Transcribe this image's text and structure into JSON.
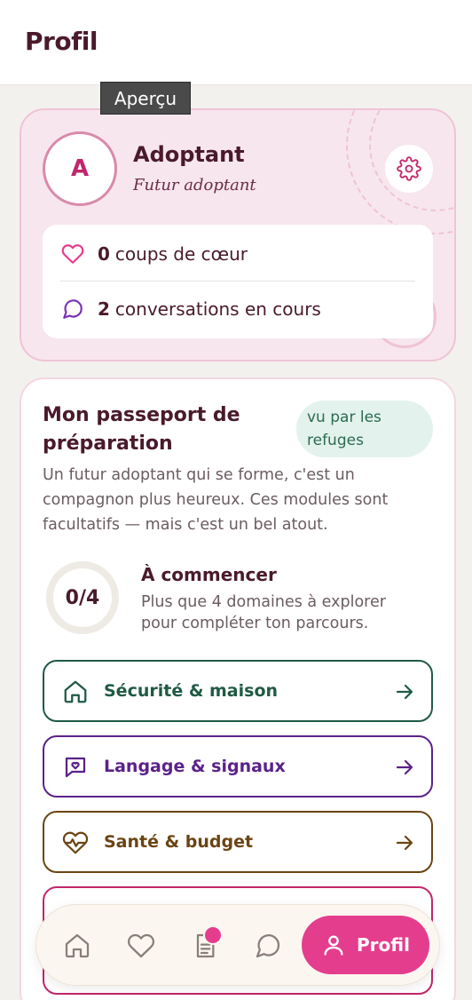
{
  "header": {
    "title": "Profil"
  },
  "tooltip": {
    "text": "Aperçu"
  },
  "profile": {
    "avatar_initial": "A",
    "name": "Adoptant",
    "role": "Futur adoptant",
    "settings_icon": "gear-icon"
  },
  "stats": [
    {
      "icon": "heart-icon",
      "count": "0",
      "label": "coups de cœur"
    },
    {
      "icon": "chat-bubble-icon",
      "count": "2",
      "label": "conversations en cours"
    }
  ],
  "passport": {
    "title": "Mon passeport de préparation",
    "badge": "vu par les refuges",
    "description": "Un futur adoptant qui se forme, c'est un compagnon plus heureux. Ces modules sont facultatifs — mais c'est un bel atout.",
    "progress": {
      "completed": 0,
      "total": 4,
      "text": "0/4"
    },
    "status_title": "À commencer",
    "status_sub": "Plus que 4 domaines à explorer pour compléter ton parcours.",
    "modules": [
      {
        "label": "Sécurité & maison",
        "icon": "home-icon",
        "color": "#1f5a44"
      },
      {
        "label": "Langage & signaux",
        "icon": "message-heart-icon",
        "color": "#5b2289"
      },
      {
        "label": "Santé & budget",
        "icon": "heart-pulse-icon",
        "color": "#6b4413"
      },
      {
        "label": "",
        "icon": "",
        "color": "#c2266a"
      }
    ]
  },
  "nav": {
    "items": [
      {
        "icon": "home-icon"
      },
      {
        "icon": "heart-icon"
      },
      {
        "icon": "document-icon",
        "has_badge": true
      },
      {
        "icon": "chat-bubble-icon"
      }
    ],
    "active": {
      "icon": "user-icon",
      "label": "Profil"
    }
  },
  "colors": {
    "brand_pink": "#e53d8e",
    "card_pink": "#f7e6ee",
    "text_dark": "#4a1a2c",
    "badge_green_bg": "#e3f2ec"
  }
}
